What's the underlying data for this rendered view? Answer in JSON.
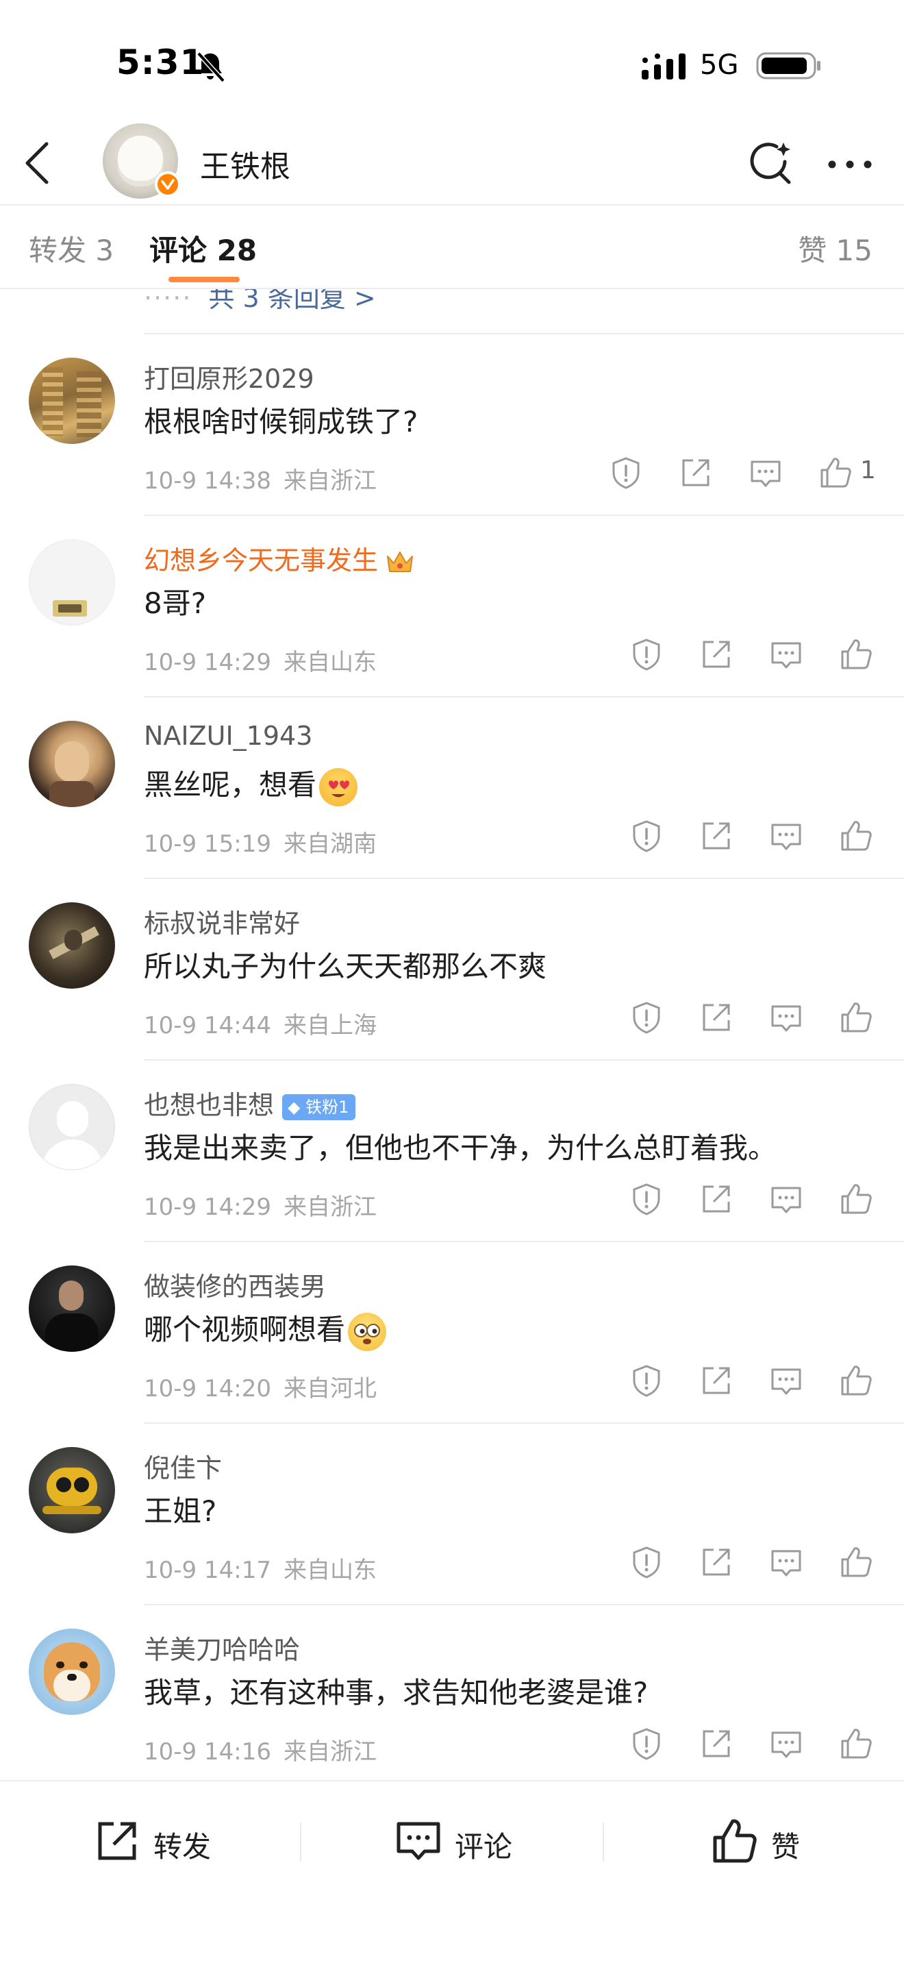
{
  "status_bar": {
    "time": "5:31",
    "network": "5G"
  },
  "header": {
    "back_icon": "chevron-left-icon",
    "title": "王铁根",
    "search_icon": "search-sparkle-icon",
    "more_icon": "more-dots-icon"
  },
  "tabs": {
    "repost": "转发 3",
    "comments": "评论 28",
    "likes": "赞 15"
  },
  "reply_more": {
    "dots": "·····",
    "label": "共 3 条回复 >"
  },
  "comments": [
    {
      "username": "打回原形2029",
      "text": "根根啥时候铜成铁了?",
      "time": "10-9 14:38",
      "location": "来自浙江",
      "likes": "1"
    },
    {
      "username": "幻想乡今天无事发生",
      "text": "8哥?",
      "time": "10-9 14:29",
      "location": "来自山东",
      "likes": ""
    },
    {
      "username": "NAIZUI_1943",
      "text": "黑丝呢，想看",
      "time": "10-9 15:19",
      "location": "来自湖南",
      "likes": ""
    },
    {
      "username": "标叔说非常好",
      "text": "所以丸子为什么天天都那么不爽",
      "time": "10-9 14:44",
      "location": "来自上海",
      "likes": ""
    },
    {
      "username": "也想也非想",
      "badge": "铁粉1",
      "text": "我是出来卖了，但他也不干净，为什么总盯着我。",
      "time": "10-9 14:29",
      "location": "来自浙江",
      "likes": ""
    },
    {
      "username": "做装修的西装男",
      "text": "哪个视频啊想看",
      "time": "10-9 14:20",
      "location": "来自河北",
      "likes": ""
    },
    {
      "username": "倪佳卞",
      "text": "王姐?",
      "time": "10-9 14:17",
      "location": "来自山东",
      "likes": ""
    },
    {
      "username": "羊美刀哈哈哈",
      "text": "我草，还有这种事，求告知他老婆是谁?",
      "time": "10-9 14:16",
      "location": "来自浙江",
      "likes": ""
    }
  ],
  "bottom_bar": {
    "repost": "转发",
    "comment": "评论",
    "like": "赞"
  },
  "colors": {
    "accent": "#ff8a3d",
    "vip_name": "#f06a1c",
    "link": "#4a6a9a",
    "meta": "#a6a6a6"
  }
}
